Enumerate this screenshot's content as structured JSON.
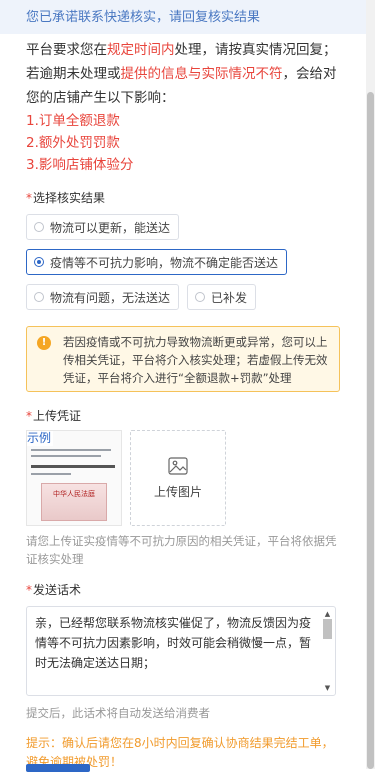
{
  "banner": {
    "text": "您已承诺联系快递核实，请回复核实结果"
  },
  "notice": {
    "part1": "平台要求您在",
    "highlight1": "规定时间内",
    "part2": "处理，请按真实情况回复；若逾期未处理或",
    "highlight2": "提供的信息与实际情况不符",
    "part3": "，会给对您的店铺产生以下影响：",
    "impacts": [
      "1.订单全额退款",
      "2.额外处罚罚款",
      "3.影响店铺体验分"
    ]
  },
  "verify": {
    "label": "选择核实结果",
    "options": [
      {
        "label": "物流可以更新，能送达",
        "checked": false
      },
      {
        "label": "疫情等不可抗力影响，物流不确定能否送达",
        "checked": true
      },
      {
        "label": "物流有问题，无法送达",
        "checked": false
      },
      {
        "label": "已补发",
        "checked": false
      }
    ]
  },
  "warning": {
    "icon": "exclamation-icon",
    "text": "若因疫情或不可抗力导致物流断更或异常，您可以上传相关凭证，平台将介入核实处理；若虚假上传无效凭证，平台将介入进行“全额退款+罚款”处理"
  },
  "upload": {
    "label": "上传凭证",
    "sample_label": "示例",
    "sample_seal_text": "中华人民法庭",
    "button_label": "上传图片",
    "hint": "请您上传证实疫情等不可抗力原因的相关凭证，平台将依据凭证核实处理"
  },
  "message": {
    "label": "发送话术",
    "value": "亲，已经帮您联系物流核实催促了，物流反馈因为疫情等不可抗力因素影响，时效可能会稍微慢一点，暂时无法确定送达日期；",
    "hint": "提交后，此话术将自动发送给消费者"
  },
  "footer_tip": "提示：确认后请您在8小时内回复确认协商结果完结工单，避免逾期被处罚！",
  "colors": {
    "accent": "#2d67c6",
    "warning": "#e8453c",
    "tip": "#f19b2d"
  }
}
